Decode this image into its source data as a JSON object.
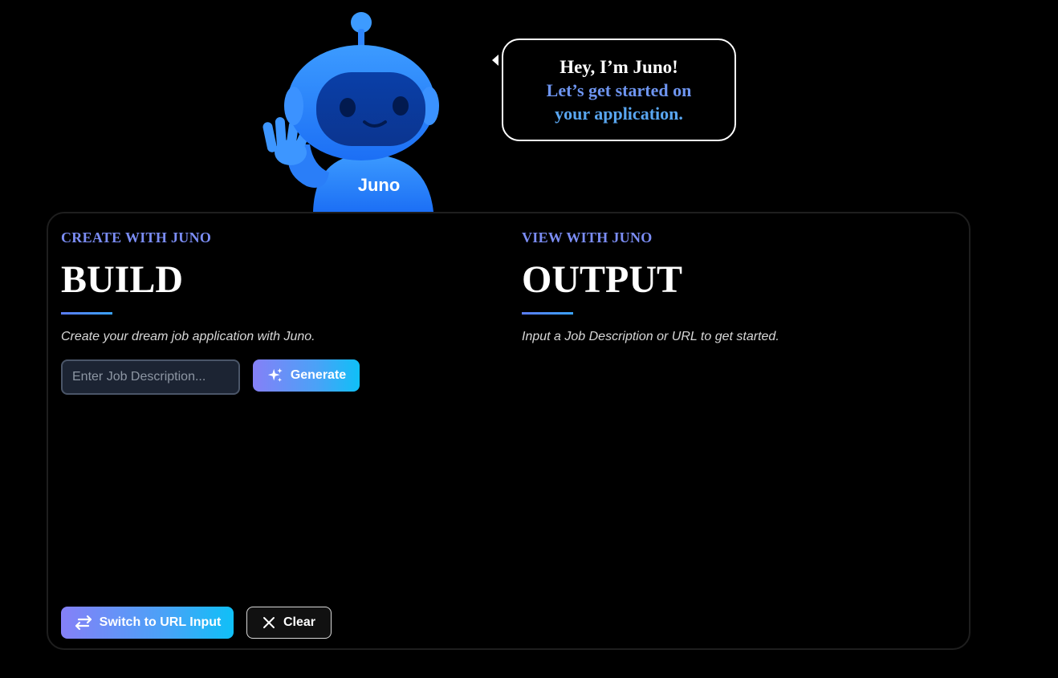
{
  "mascot": {
    "name_label": "Juno",
    "icon": "robot-mascot-icon"
  },
  "bubble": {
    "greeting": "Hey, I’m Juno!",
    "line1": "Let’s get started on",
    "line2": "your application."
  },
  "build": {
    "eyebrow": "CREATE WITH JUNO",
    "title": "BUILD",
    "description": "Create your dream job application with Juno.",
    "input_placeholder": "Enter Job Description...",
    "generate_label": "Generate",
    "switch_label": "Switch to URL Input",
    "clear_label": "Clear"
  },
  "output": {
    "eyebrow": "VIEW WITH JUNO",
    "title": "OUTPUT",
    "description": "Input a Job Description or URL to get started."
  },
  "colors": {
    "accent_purple": "#7b8df5",
    "gradient_start": "#8580f7",
    "gradient_end": "#0fc0f7",
    "mascot_blue": "#2f86ff"
  }
}
